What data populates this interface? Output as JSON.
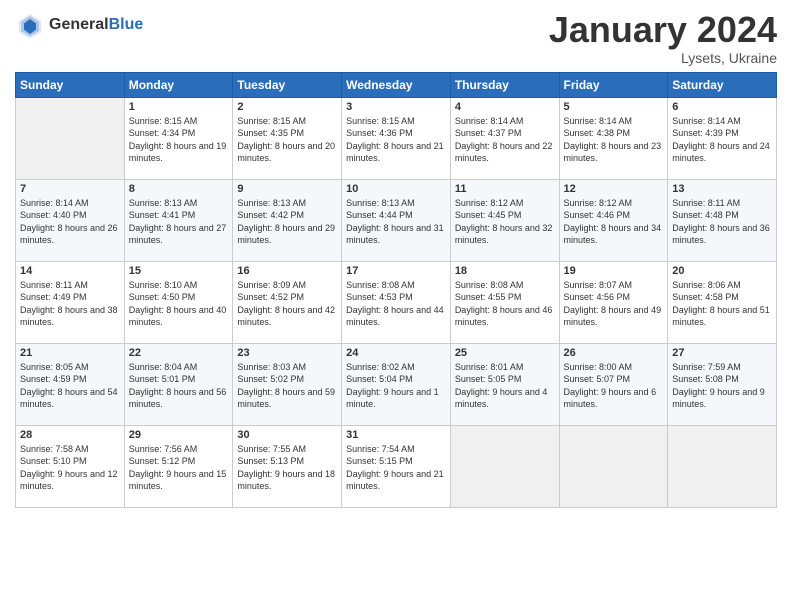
{
  "header": {
    "logo_general": "General",
    "logo_blue": "Blue",
    "month_year": "January 2024",
    "location": "Lysets, Ukraine"
  },
  "weekdays": [
    "Sunday",
    "Monday",
    "Tuesday",
    "Wednesday",
    "Thursday",
    "Friday",
    "Saturday"
  ],
  "weeks": [
    [
      {
        "day": "",
        "sunrise": "",
        "sunset": "",
        "daylight": "",
        "empty": true
      },
      {
        "day": "1",
        "sunrise": "Sunrise: 8:15 AM",
        "sunset": "Sunset: 4:34 PM",
        "daylight": "Daylight: 8 hours and 19 minutes."
      },
      {
        "day": "2",
        "sunrise": "Sunrise: 8:15 AM",
        "sunset": "Sunset: 4:35 PM",
        "daylight": "Daylight: 8 hours and 20 minutes."
      },
      {
        "day": "3",
        "sunrise": "Sunrise: 8:15 AM",
        "sunset": "Sunset: 4:36 PM",
        "daylight": "Daylight: 8 hours and 21 minutes."
      },
      {
        "day": "4",
        "sunrise": "Sunrise: 8:14 AM",
        "sunset": "Sunset: 4:37 PM",
        "daylight": "Daylight: 8 hours and 22 minutes."
      },
      {
        "day": "5",
        "sunrise": "Sunrise: 8:14 AM",
        "sunset": "Sunset: 4:38 PM",
        "daylight": "Daylight: 8 hours and 23 minutes."
      },
      {
        "day": "6",
        "sunrise": "Sunrise: 8:14 AM",
        "sunset": "Sunset: 4:39 PM",
        "daylight": "Daylight: 8 hours and 24 minutes."
      }
    ],
    [
      {
        "day": "7",
        "sunrise": "Sunrise: 8:14 AM",
        "sunset": "Sunset: 4:40 PM",
        "daylight": "Daylight: 8 hours and 26 minutes."
      },
      {
        "day": "8",
        "sunrise": "Sunrise: 8:13 AM",
        "sunset": "Sunset: 4:41 PM",
        "daylight": "Daylight: 8 hours and 27 minutes."
      },
      {
        "day": "9",
        "sunrise": "Sunrise: 8:13 AM",
        "sunset": "Sunset: 4:42 PM",
        "daylight": "Daylight: 8 hours and 29 minutes."
      },
      {
        "day": "10",
        "sunrise": "Sunrise: 8:13 AM",
        "sunset": "Sunset: 4:44 PM",
        "daylight": "Daylight: 8 hours and 31 minutes."
      },
      {
        "day": "11",
        "sunrise": "Sunrise: 8:12 AM",
        "sunset": "Sunset: 4:45 PM",
        "daylight": "Daylight: 8 hours and 32 minutes."
      },
      {
        "day": "12",
        "sunrise": "Sunrise: 8:12 AM",
        "sunset": "Sunset: 4:46 PM",
        "daylight": "Daylight: 8 hours and 34 minutes."
      },
      {
        "day": "13",
        "sunrise": "Sunrise: 8:11 AM",
        "sunset": "Sunset: 4:48 PM",
        "daylight": "Daylight: 8 hours and 36 minutes."
      }
    ],
    [
      {
        "day": "14",
        "sunrise": "Sunrise: 8:11 AM",
        "sunset": "Sunset: 4:49 PM",
        "daylight": "Daylight: 8 hours and 38 minutes."
      },
      {
        "day": "15",
        "sunrise": "Sunrise: 8:10 AM",
        "sunset": "Sunset: 4:50 PM",
        "daylight": "Daylight: 8 hours and 40 minutes."
      },
      {
        "day": "16",
        "sunrise": "Sunrise: 8:09 AM",
        "sunset": "Sunset: 4:52 PM",
        "daylight": "Daylight: 8 hours and 42 minutes."
      },
      {
        "day": "17",
        "sunrise": "Sunrise: 8:08 AM",
        "sunset": "Sunset: 4:53 PM",
        "daylight": "Daylight: 8 hours and 44 minutes."
      },
      {
        "day": "18",
        "sunrise": "Sunrise: 8:08 AM",
        "sunset": "Sunset: 4:55 PM",
        "daylight": "Daylight: 8 hours and 46 minutes."
      },
      {
        "day": "19",
        "sunrise": "Sunrise: 8:07 AM",
        "sunset": "Sunset: 4:56 PM",
        "daylight": "Daylight: 8 hours and 49 minutes."
      },
      {
        "day": "20",
        "sunrise": "Sunrise: 8:06 AM",
        "sunset": "Sunset: 4:58 PM",
        "daylight": "Daylight: 8 hours and 51 minutes."
      }
    ],
    [
      {
        "day": "21",
        "sunrise": "Sunrise: 8:05 AM",
        "sunset": "Sunset: 4:59 PM",
        "daylight": "Daylight: 8 hours and 54 minutes."
      },
      {
        "day": "22",
        "sunrise": "Sunrise: 8:04 AM",
        "sunset": "Sunset: 5:01 PM",
        "daylight": "Daylight: 8 hours and 56 minutes."
      },
      {
        "day": "23",
        "sunrise": "Sunrise: 8:03 AM",
        "sunset": "Sunset: 5:02 PM",
        "daylight": "Daylight: 8 hours and 59 minutes."
      },
      {
        "day": "24",
        "sunrise": "Sunrise: 8:02 AM",
        "sunset": "Sunset: 5:04 PM",
        "daylight": "Daylight: 9 hours and 1 minute."
      },
      {
        "day": "25",
        "sunrise": "Sunrise: 8:01 AM",
        "sunset": "Sunset: 5:05 PM",
        "daylight": "Daylight: 9 hours and 4 minutes."
      },
      {
        "day": "26",
        "sunrise": "Sunrise: 8:00 AM",
        "sunset": "Sunset: 5:07 PM",
        "daylight": "Daylight: 9 hours and 6 minutes."
      },
      {
        "day": "27",
        "sunrise": "Sunrise: 7:59 AM",
        "sunset": "Sunset: 5:08 PM",
        "daylight": "Daylight: 9 hours and 9 minutes."
      }
    ],
    [
      {
        "day": "28",
        "sunrise": "Sunrise: 7:58 AM",
        "sunset": "Sunset: 5:10 PM",
        "daylight": "Daylight: 9 hours and 12 minutes."
      },
      {
        "day": "29",
        "sunrise": "Sunrise: 7:56 AM",
        "sunset": "Sunset: 5:12 PM",
        "daylight": "Daylight: 9 hours and 15 minutes."
      },
      {
        "day": "30",
        "sunrise": "Sunrise: 7:55 AM",
        "sunset": "Sunset: 5:13 PM",
        "daylight": "Daylight: 9 hours and 18 minutes."
      },
      {
        "day": "31",
        "sunrise": "Sunrise: 7:54 AM",
        "sunset": "Sunset: 5:15 PM",
        "daylight": "Daylight: 9 hours and 21 minutes."
      },
      {
        "day": "",
        "sunrise": "",
        "sunset": "",
        "daylight": "",
        "empty": true
      },
      {
        "day": "",
        "sunrise": "",
        "sunset": "",
        "daylight": "",
        "empty": true
      },
      {
        "day": "",
        "sunrise": "",
        "sunset": "",
        "daylight": "",
        "empty": true
      }
    ]
  ]
}
